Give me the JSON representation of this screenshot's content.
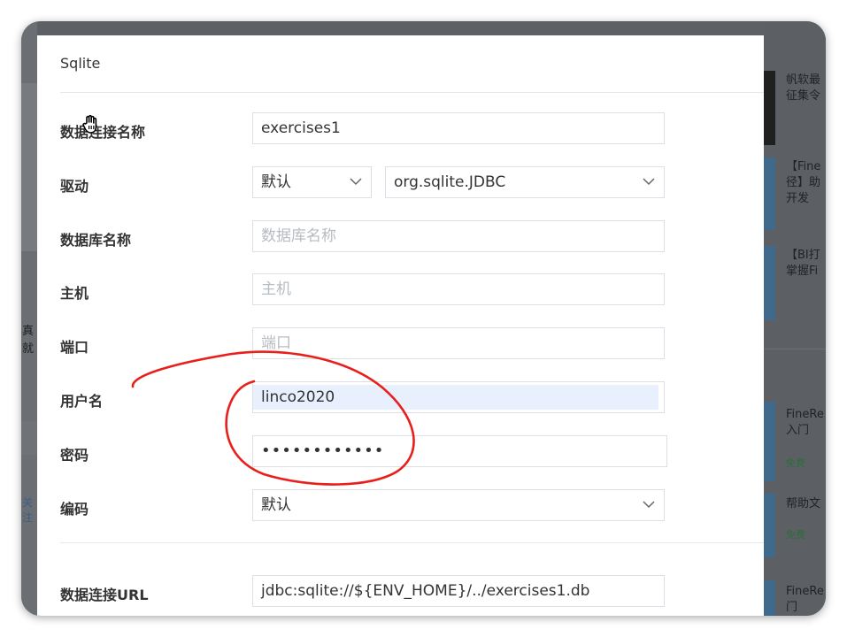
{
  "dialog": {
    "title": "Sqlite",
    "fields": {
      "connection_name": {
        "label": "数据连接名称",
        "value": "exercises1"
      },
      "driver": {
        "label": "驱动",
        "mode": "默认",
        "class": "org.sqlite.JDBC"
      },
      "database": {
        "label": "数据库名称",
        "placeholder": "数据库名称"
      },
      "host": {
        "label": "主机",
        "placeholder": "主机"
      },
      "port": {
        "label": "端口",
        "placeholder": "端口"
      },
      "username": {
        "label": "用户名",
        "value": "linco2020"
      },
      "password": {
        "label": "密码",
        "value": "••••••••••••"
      },
      "encoding": {
        "label": "编码",
        "value": "默认"
      },
      "url": {
        "label": "数据连接URL",
        "value": "jdbc:sqlite://${ENV_HOME}/../exercises1.db"
      }
    }
  },
  "background_right": {
    "items": [
      {
        "text": "帆软最\n征集令"
      },
      {
        "text": "【Fine\n径】助\n开发"
      },
      {
        "text": "【BI打\n掌握Fi"
      },
      {
        "text": "FineRe\n入门",
        "badge": "免费"
      },
      {
        "text": "帮助文",
        "badge": "免费"
      },
      {
        "text": "FineRe\n门"
      }
    ]
  },
  "background_left": {
    "texts": [
      "真",
      "就",
      "关注"
    ]
  },
  "colors": {
    "annotation": "#e8201c",
    "highlight": "#e8f0fe",
    "border": "#dcdfe6",
    "placeholder": "#b7bbc2"
  },
  "icons": {
    "cursor": "hand-cursor-icon",
    "dropdown": "chevron-down-icon"
  }
}
